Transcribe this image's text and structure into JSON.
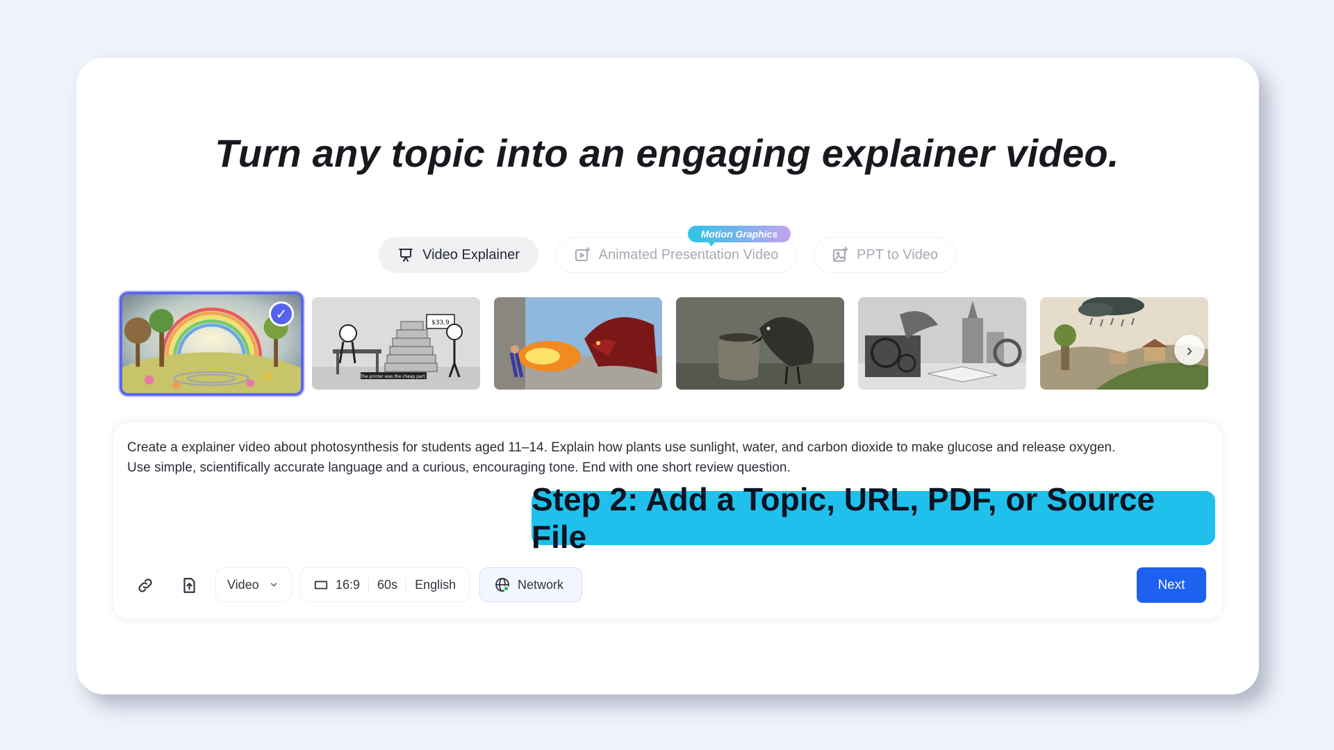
{
  "headline": "Turn any topic into an engaging explainer video.",
  "tabs": [
    {
      "label": "Video Explainer",
      "icon": "presentation-icon",
      "active": true
    },
    {
      "label": "Animated Presentation Video",
      "icon": "video-add-icon",
      "active": false
    },
    {
      "label": "PPT to Video",
      "icon": "image-add-icon",
      "active": false
    }
  ],
  "badge": "Motion Graphics",
  "thumbnails": [
    {
      "style": "felt-rainbow-meadow",
      "selected": true
    },
    {
      "style": "sketch-cartoon"
    },
    {
      "style": "3d-dragon-fire"
    },
    {
      "style": "clay-crow-pot"
    },
    {
      "style": "monochrome-paper-city"
    },
    {
      "style": "papercraft-rainy-village"
    }
  ],
  "thumb_text": {
    "sign": "$33,9",
    "caption": "The printer was the cheap part."
  },
  "prompt": {
    "line1": "Create a explainer video about photosynthesis for students aged 11–14. Explain how plants use sunlight, water, and carbon dioxide to make glucose and release oxygen.",
    "line2": "Use simple, scientifically accurate language and a curious, encouraging tone. End with one short review question."
  },
  "step_banner": "Step 2: Add a Topic, URL, PDF, or Source File",
  "toolbar": {
    "link_icon": "link-icon",
    "upload_icon": "upload-file-icon",
    "type_select": "Video",
    "aspect": "16:9",
    "duration": "60s",
    "language": "English",
    "network": "Network",
    "next": "Next"
  },
  "colors": {
    "accent": "#1e60f0",
    "selected_border": "#5b66ee",
    "banner": "#1fc1ec",
    "background": "#eef2fb"
  }
}
